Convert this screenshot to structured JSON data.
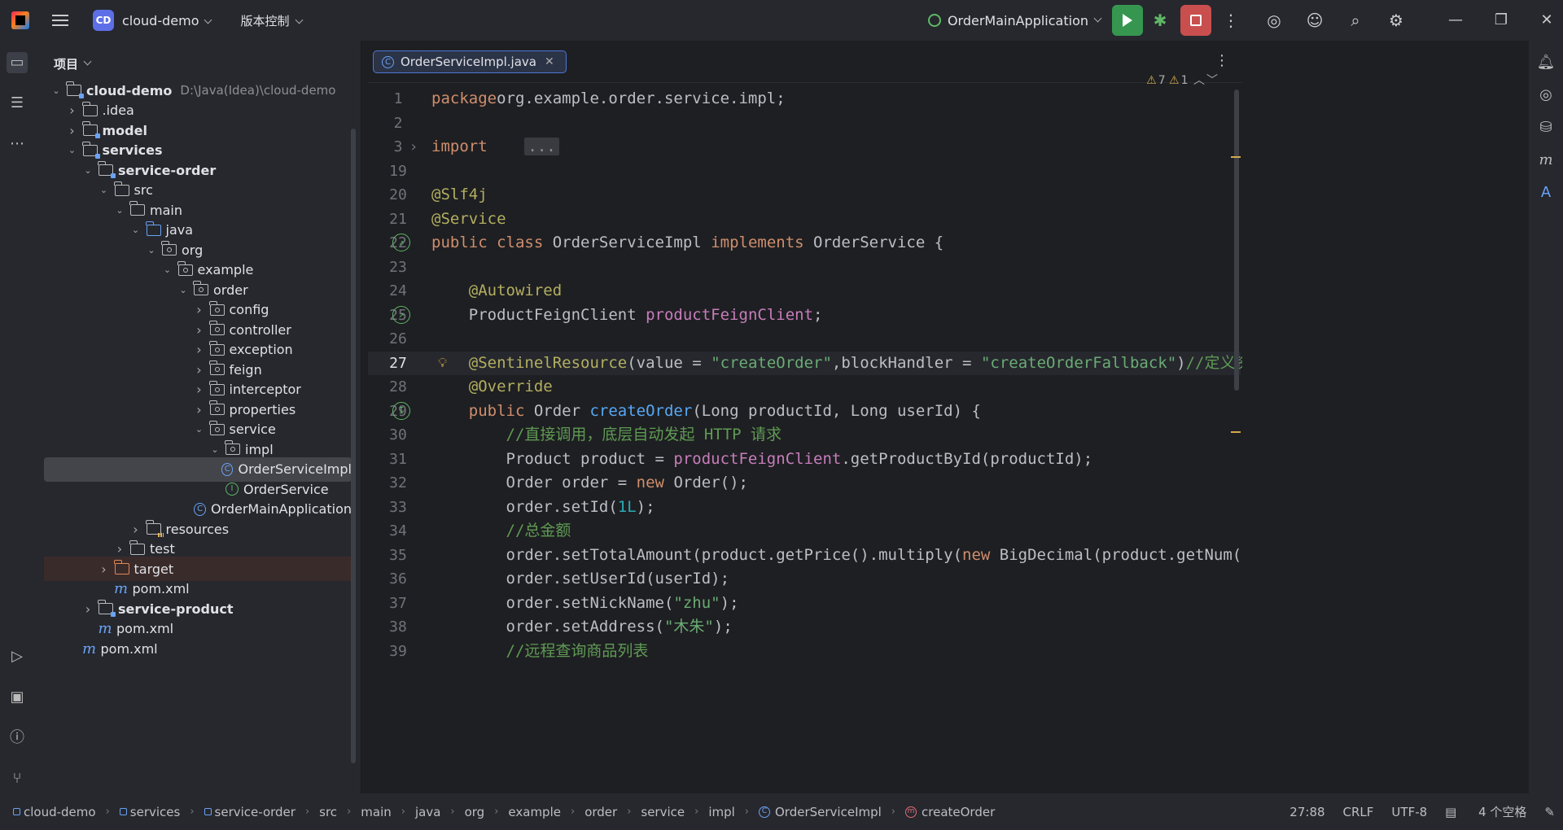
{
  "titlebar": {
    "project_badge": "CD",
    "project_name": "cloud-demo",
    "vcs_label": "版本控制",
    "run_config": "OrderMainApplication"
  },
  "project_panel": {
    "title": "项目",
    "tree": [
      {
        "label": "cloud-demo",
        "path": "D:\\Java(Idea)\\cloud-demo",
        "depth": 0,
        "expanded": true,
        "icon": "module-folder",
        "bold": true
      },
      {
        "label": ".idea",
        "depth": 1,
        "expanded": false,
        "icon": "folder"
      },
      {
        "label": "model",
        "depth": 1,
        "expanded": false,
        "icon": "module-folder",
        "bold": true
      },
      {
        "label": "services",
        "depth": 1,
        "expanded": true,
        "icon": "module-folder",
        "bold": true
      },
      {
        "label": "service-order",
        "depth": 2,
        "expanded": true,
        "icon": "module-folder",
        "bold": true
      },
      {
        "label": "src",
        "depth": 3,
        "expanded": true,
        "icon": "folder"
      },
      {
        "label": "main",
        "depth": 4,
        "expanded": true,
        "icon": "folder"
      },
      {
        "label": "java",
        "depth": 5,
        "expanded": true,
        "icon": "source-folder"
      },
      {
        "label": "org",
        "depth": 6,
        "expanded": true,
        "icon": "package"
      },
      {
        "label": "example",
        "depth": 7,
        "expanded": true,
        "icon": "package"
      },
      {
        "label": "order",
        "depth": 8,
        "expanded": true,
        "icon": "package"
      },
      {
        "label": "config",
        "depth": 9,
        "expanded": false,
        "icon": "package"
      },
      {
        "label": "controller",
        "depth": 9,
        "expanded": false,
        "icon": "package"
      },
      {
        "label": "exception",
        "depth": 9,
        "expanded": false,
        "icon": "package"
      },
      {
        "label": "feign",
        "depth": 9,
        "expanded": false,
        "icon": "package"
      },
      {
        "label": "interceptor",
        "depth": 9,
        "expanded": false,
        "icon": "package"
      },
      {
        "label": "properties",
        "depth": 9,
        "expanded": false,
        "icon": "package"
      },
      {
        "label": "service",
        "depth": 9,
        "expanded": true,
        "icon": "package"
      },
      {
        "label": "impl",
        "depth": 10,
        "expanded": true,
        "icon": "package"
      },
      {
        "label": "OrderServiceImpl",
        "depth": 11,
        "icon": "class",
        "selected": true
      },
      {
        "label": "OrderService",
        "depth": 10,
        "icon": "interface"
      },
      {
        "label": "OrderMainApplication",
        "depth": 9,
        "icon": "class-app"
      },
      {
        "label": "resources",
        "depth": 5,
        "expanded": false,
        "icon": "resources-folder"
      },
      {
        "label": "test",
        "depth": 4,
        "expanded": false,
        "icon": "folder"
      },
      {
        "label": "target",
        "depth": 3,
        "expanded": false,
        "icon": "excluded-folder",
        "highlight": true
      },
      {
        "label": "pom.xml",
        "depth": 3,
        "icon": "maven"
      },
      {
        "label": "service-product",
        "depth": 2,
        "expanded": false,
        "icon": "module-folder",
        "bold": true
      },
      {
        "label": "pom.xml",
        "depth": 2,
        "icon": "maven"
      },
      {
        "label": "pom.xml",
        "depth": 1,
        "icon": "maven"
      }
    ]
  },
  "editor": {
    "tab_label": "OrderServiceImpl.java",
    "warnings": "7",
    "weak_warnings": "1",
    "current_line": "27",
    "lines": [
      {
        "n": "1",
        "tokens": [
          [
            "kw",
            "package"
          ],
          [
            "",
            "org.example.order.service.impl;"
          ]
        ]
      },
      {
        "n": "2",
        "tokens": []
      },
      {
        "n": "3",
        "tokens": [
          [
            "kw",
            "import"
          ],
          [
            "",
            " "
          ],
          [
            "fold",
            "..."
          ]
        ]
      },
      {
        "n": "19",
        "tokens": []
      },
      {
        "n": "20",
        "tokens": [
          [
            "ann",
            "@Slf4j"
          ]
        ]
      },
      {
        "n": "21",
        "tokens": [
          [
            "ann",
            "@Service"
          ]
        ]
      },
      {
        "n": "22",
        "tokens": [
          [
            "kw",
            "public class"
          ],
          [
            "",
            " OrderServiceImpl "
          ],
          [
            "kw",
            "implements"
          ],
          [
            "",
            " OrderService {"
          ]
        ]
      },
      {
        "n": "23",
        "tokens": []
      },
      {
        "n": "24",
        "tokens": [
          [
            "",
            " "
          ],
          [
            "ann",
            "@Autowired"
          ]
        ]
      },
      {
        "n": "25",
        "tokens": [
          [
            "",
            "    ProductFeignClient "
          ],
          [
            "fld",
            "productFeignClient"
          ],
          [
            "",
            ";"
          ]
        ]
      },
      {
        "n": "26",
        "tokens": []
      },
      {
        "n": "27",
        "tokens": [
          [
            "",
            " "
          ],
          [
            "ann",
            "@SentinelResource"
          ],
          [
            "",
            "(value = "
          ],
          [
            "str",
            "\"createOrder\""
          ],
          [
            "",
            ",blockHandler = "
          ],
          [
            "str",
            "\"createOrderFallback\""
          ],
          [
            "",
            ")"
          ],
          [
            "cmtg",
            "//定义资源"
          ]
        ]
      },
      {
        "n": "28",
        "tokens": [
          [
            "",
            " "
          ],
          [
            "ann",
            "@Override"
          ]
        ]
      },
      {
        "n": "29",
        "tokens": [
          [
            "",
            " "
          ],
          [
            "kw",
            "public"
          ],
          [
            "",
            " Order "
          ],
          [
            "fn",
            "createOrder"
          ],
          [
            "",
            "(Long productId, Long userId) {"
          ]
        ]
      },
      {
        "n": "30",
        "tokens": [
          [
            "",
            "        "
          ],
          [
            "cmtg",
            "//直接调用，底层自动发起 HTTP 请求"
          ]
        ]
      },
      {
        "n": "31",
        "tokens": [
          [
            "",
            "        Product product = "
          ],
          [
            "fld",
            "productFeignClient"
          ],
          [
            "",
            ".getProductById(productId);"
          ]
        ]
      },
      {
        "n": "32",
        "tokens": [
          [
            "",
            "        Order order = "
          ],
          [
            "kw",
            "new"
          ],
          [
            "",
            " Order();"
          ]
        ]
      },
      {
        "n": "33",
        "tokens": [
          [
            "",
            "        order.setId("
          ],
          [
            "num",
            "1L"
          ],
          [
            "",
            ");"
          ]
        ]
      },
      {
        "n": "34",
        "tokens": [
          [
            "",
            "        "
          ],
          [
            "cmtg",
            "//总金额"
          ]
        ]
      },
      {
        "n": "35",
        "tokens": [
          [
            "",
            "        order.setTotalAmount(product.getPrice().multiply("
          ],
          [
            "kw",
            "new"
          ],
          [
            "",
            " BigDecimal(product.getNum())));"
          ]
        ]
      },
      {
        "n": "36",
        "tokens": [
          [
            "",
            "        order.setUserId(userId);"
          ]
        ]
      },
      {
        "n": "37",
        "tokens": [
          [
            "",
            "        order.setNickName("
          ],
          [
            "str",
            "\"zhu\""
          ],
          [
            "",
            ");"
          ]
        ]
      },
      {
        "n": "38",
        "tokens": [
          [
            "",
            "        order.setAddress("
          ],
          [
            "str",
            "\"木朱\""
          ],
          [
            "",
            ");"
          ]
        ]
      },
      {
        "n": "39",
        "tokens": [
          [
            "",
            "        "
          ],
          [
            "cmtg",
            "//远程查询商品列表"
          ]
        ]
      }
    ]
  },
  "statusbar": {
    "breadcrumb": [
      "cloud-demo",
      "services",
      "service-order",
      "src",
      "main",
      "java",
      "org",
      "example",
      "order",
      "service",
      "impl",
      "OrderServiceImpl",
      "createOrder"
    ],
    "position": "27:88",
    "line_ending": "CRLF",
    "encoding": "UTF-8",
    "indent": "4 个空格"
  }
}
